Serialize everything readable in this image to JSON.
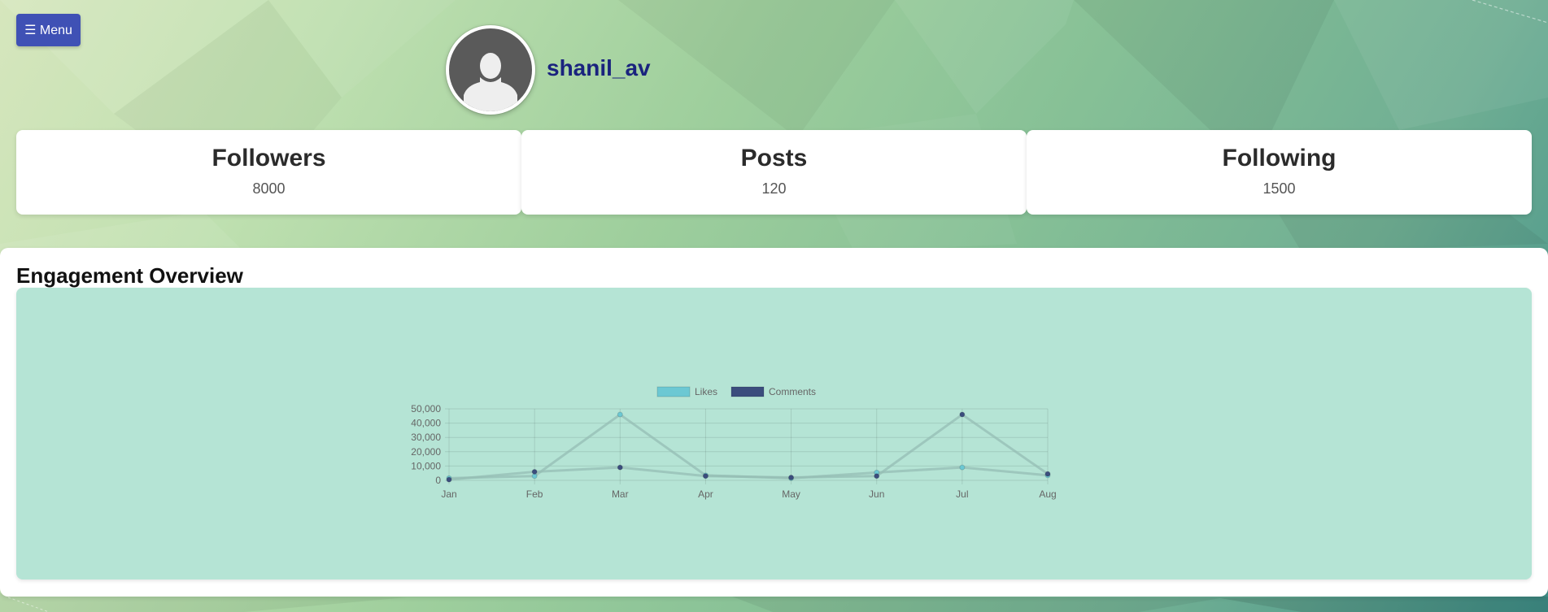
{
  "header": {
    "menu_label": "☰ Menu",
    "username": "shanil_av"
  },
  "stats": [
    {
      "label": "Followers",
      "value": "8000"
    },
    {
      "label": "Posts",
      "value": "120"
    },
    {
      "label": "Following",
      "value": "1500"
    }
  ],
  "engagement": {
    "title": "Engagement Overview"
  },
  "colors": {
    "menu": "#3f51b5",
    "username": "#1a237e",
    "chart_bg": "#b5e4d5",
    "likes": "#6cc8d3",
    "comments": "#3b4d7d"
  },
  "chart_data": {
    "type": "line",
    "categories": [
      "Jan",
      "Feb",
      "Mar",
      "Apr",
      "May",
      "Jun",
      "Jul",
      "Aug"
    ],
    "series": [
      {
        "name": "Likes",
        "values": [
          1500,
          3000,
          46000,
          3500,
          1500,
          5500,
          9000,
          3500
        ]
      },
      {
        "name": "Comments",
        "values": [
          500,
          6000,
          9000,
          3000,
          2000,
          3000,
          46000,
          4500
        ]
      }
    ],
    "y_ticks": [
      "50,000",
      "40,000",
      "30,000",
      "20,000",
      "10,000",
      "0"
    ],
    "ylim": [
      0,
      50000
    ],
    "grid": true,
    "legend": "top-center",
    "title": "",
    "xlabel": "",
    "ylabel": ""
  }
}
